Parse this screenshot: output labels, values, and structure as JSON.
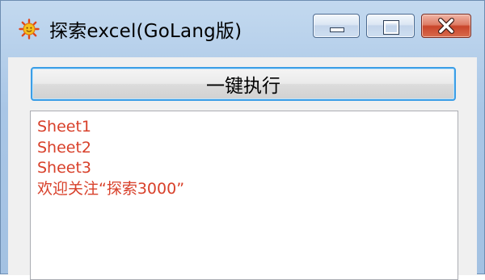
{
  "window": {
    "title": "探索excel(GoLang版)",
    "icon": "sun-icon",
    "controls": [
      "minimize-icon",
      "maximize-icon",
      "close-icon"
    ]
  },
  "main": {
    "run_button_label": "一键执行",
    "output_lines": [
      "Sheet1",
      "Sheet2",
      "Sheet3",
      "欢迎关注“探索3000”"
    ]
  },
  "colors": {
    "output_text": "#d8402a",
    "button_focus_border": "#3c9ee6",
    "close_button": "#c9452a"
  }
}
